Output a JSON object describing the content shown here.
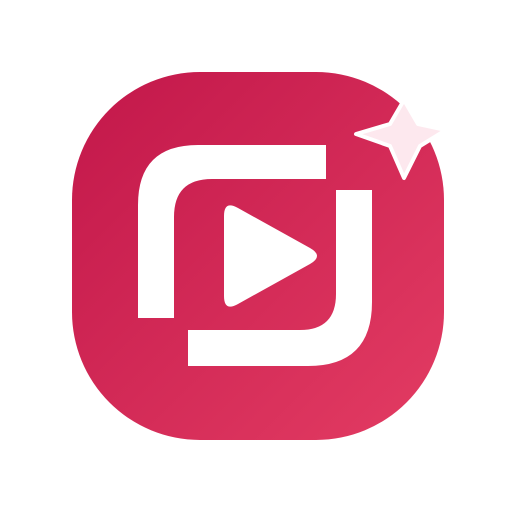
{
  "app_icon": {
    "name": "video-editor-app-icon",
    "colors": {
      "background": "#ffffff",
      "tile_gradient_start": "#c2174a",
      "tile_gradient_end": "#e33c63",
      "glyph": "#ffffff",
      "sparkle_fill": "#fde8ee",
      "sparkle_stroke": "#ffffff"
    },
    "icons": [
      "app-tile",
      "crop-frame-icon",
      "play-icon",
      "sparkle-icon"
    ]
  }
}
